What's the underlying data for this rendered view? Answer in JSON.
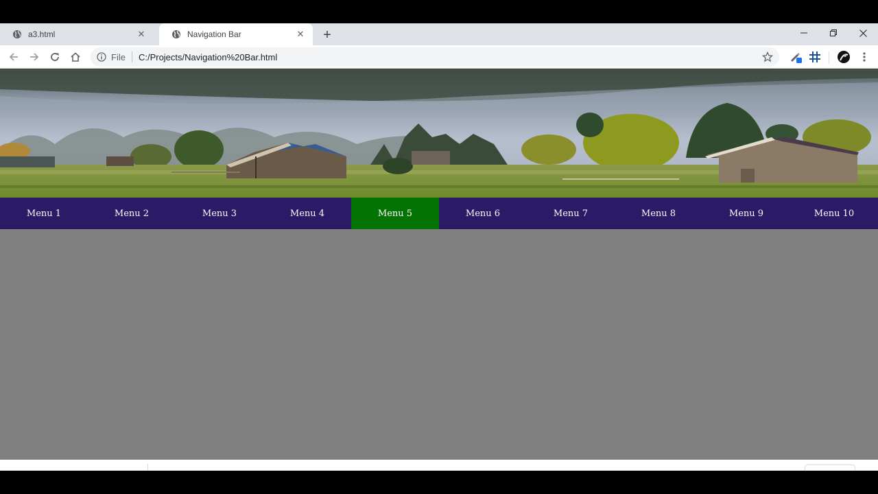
{
  "browser": {
    "tabs": [
      {
        "title": "a3.html",
        "active": false
      },
      {
        "title": "Navigation Bar",
        "active": true
      }
    ],
    "address": {
      "scheme_label": "File",
      "url": "C:/Projects/Navigation%20Bar.html"
    }
  },
  "page": {
    "background_color": "#808080",
    "navbar": {
      "background_color": "#2b1a66",
      "active_color": "#037303",
      "items": [
        {
          "label": "Menu 1"
        },
        {
          "label": "Menu 2"
        },
        {
          "label": "Menu 3"
        },
        {
          "label": "Menu 4"
        },
        {
          "label": "Menu 5",
          "active": true
        },
        {
          "label": "Menu 6"
        },
        {
          "label": "Menu 7"
        },
        {
          "label": "Menu 8"
        },
        {
          "label": "Menu 9"
        },
        {
          "label": "Menu 10"
        }
      ]
    }
  },
  "icons": [
    "globe-icon",
    "close-icon",
    "plus-icon",
    "minimize-icon",
    "restore-icon",
    "back-icon",
    "forward-icon",
    "reload-icon",
    "home-icon",
    "info-icon",
    "star-icon",
    "extension-pen-icon",
    "grid-hash-icon",
    "profile-avatar-icon",
    "kebab-menu-icon"
  ]
}
